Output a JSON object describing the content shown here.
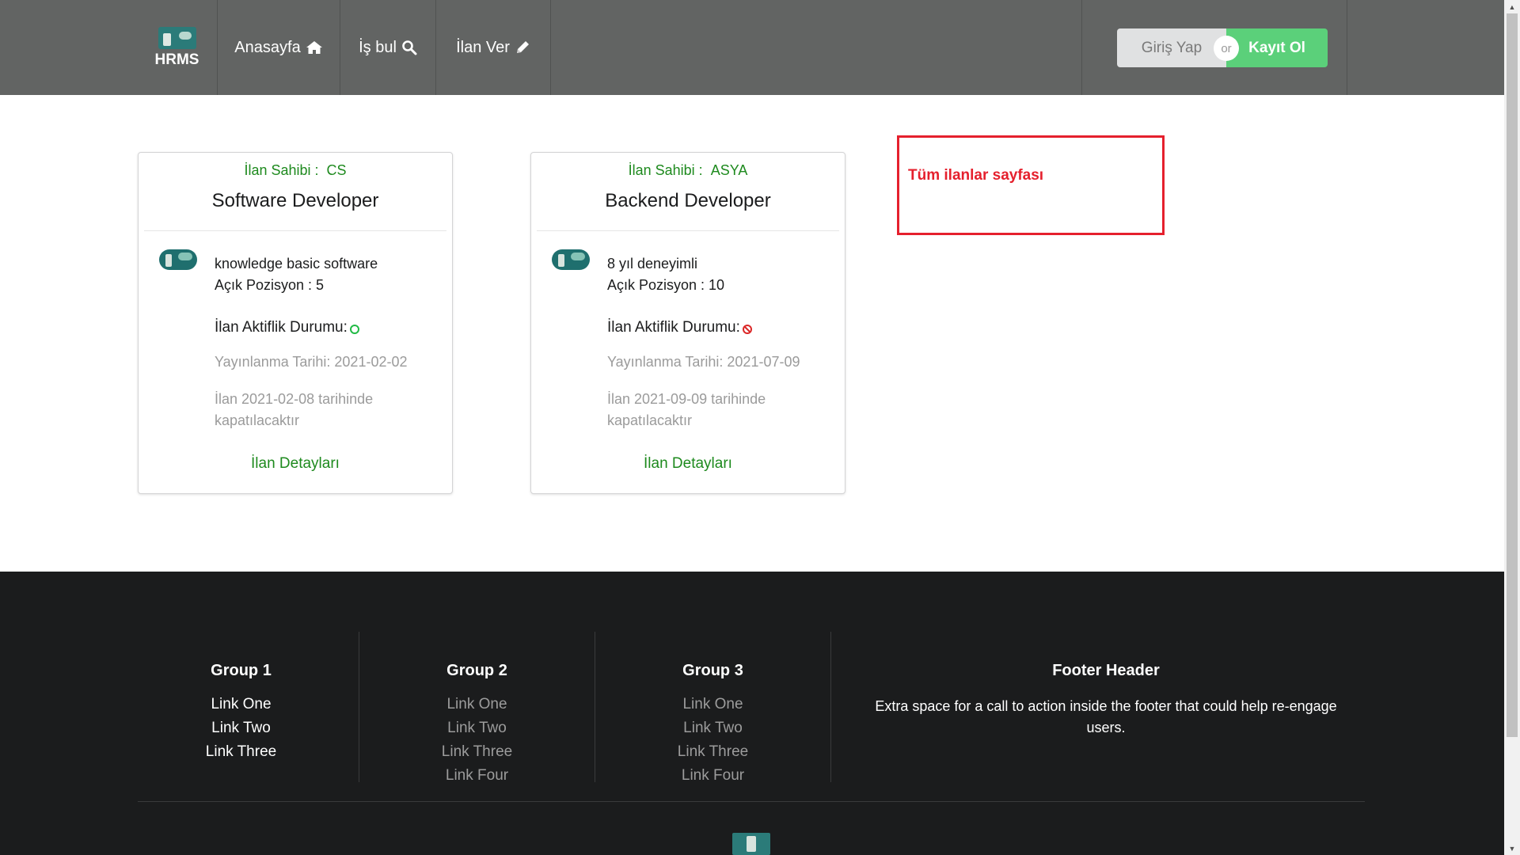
{
  "nav": {
    "logo_text": "HRMS",
    "home_label": "Anasayfa",
    "find_job_label": "İş bul",
    "post_job_label": "İlan Ver",
    "login_label": "Giriş Yap",
    "or_label": "or",
    "register_label": "Kayıt Ol"
  },
  "icons": {
    "home": "home-icon",
    "search": "search-icon",
    "post": "pencil-icon",
    "active": "circle-outline-icon",
    "inactive": "ban-icon"
  },
  "colors": {
    "topbar": "#626463",
    "green_text": "#1e8a1e",
    "register_button": "#5bd07a",
    "annotation": "#e5202d",
    "footer": "#1b1c1d"
  },
  "cards": [
    {
      "owner_label": "İlan Sahibi :",
      "owner": "CS",
      "title": "Software Developer",
      "description": "knowledge basic software",
      "positions": "Açık Pozisyon : 5",
      "status_label": "İlan Aktiflik Durumu:",
      "status": "active",
      "published": "Yayınlanma Tarihi: 2021-02-02",
      "closing": "İlan 2021-02-08 tarihinde kapatılacaktır",
      "detail_link": "İlan Detayları"
    },
    {
      "owner_label": "İlan Sahibi :",
      "owner": "ASYA",
      "title": "Backend Developer",
      "description": "8 yıl deneyimli",
      "positions": "Açık Pozisyon : 10",
      "status_label": "İlan Aktiflik Durumu:",
      "status": "inactive",
      "published": "Yayınlanma Tarihi: 2021-07-09",
      "closing": "İlan 2021-09-09 tarihinde kapatılacaktır",
      "detail_link": "İlan Detayları"
    }
  ],
  "annotation": {
    "text": "Tüm ilanlar sayfası"
  },
  "footer": {
    "groups": [
      {
        "title": "Group 1",
        "links": [
          "Link One",
          "Link Two",
          "Link Three"
        ]
      },
      {
        "title": "Group 2",
        "links": [
          "Link One",
          "Link Two",
          "Link Three",
          "Link Four"
        ]
      },
      {
        "title": "Group 3",
        "links": [
          "Link One",
          "Link Two",
          "Link Three",
          "Link Four"
        ]
      }
    ],
    "header": "Footer Header",
    "text": "Extra space for a call to action inside the footer that could help re-engage users."
  }
}
